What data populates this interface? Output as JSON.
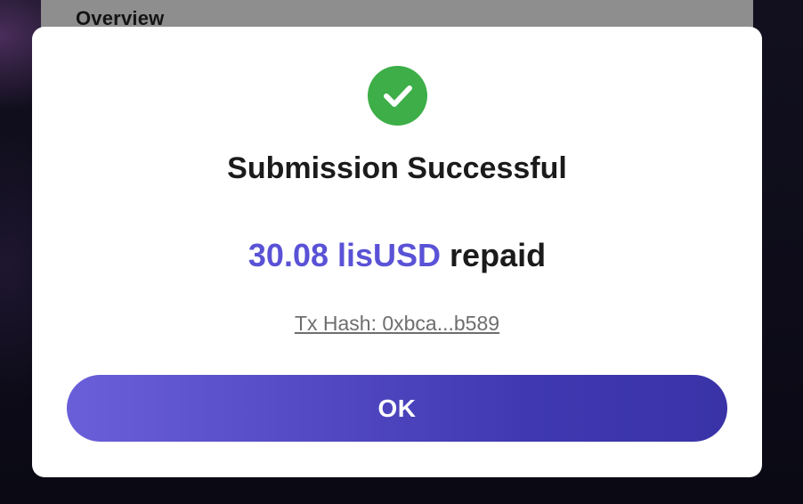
{
  "background": {
    "card_title": "Overview"
  },
  "modal": {
    "icon": "check-circle-icon",
    "title": "Submission Successful",
    "amount": "30.08 lisUSD",
    "amount_suffix": "repaid",
    "tx_hash": "Tx Hash: 0xbca...b589",
    "ok_label": "OK"
  },
  "colors": {
    "success": "#3dae48",
    "accent": "#5a52d6",
    "button_gradient_start": "#6a5fd9",
    "button_gradient_end": "#3a33a8"
  }
}
